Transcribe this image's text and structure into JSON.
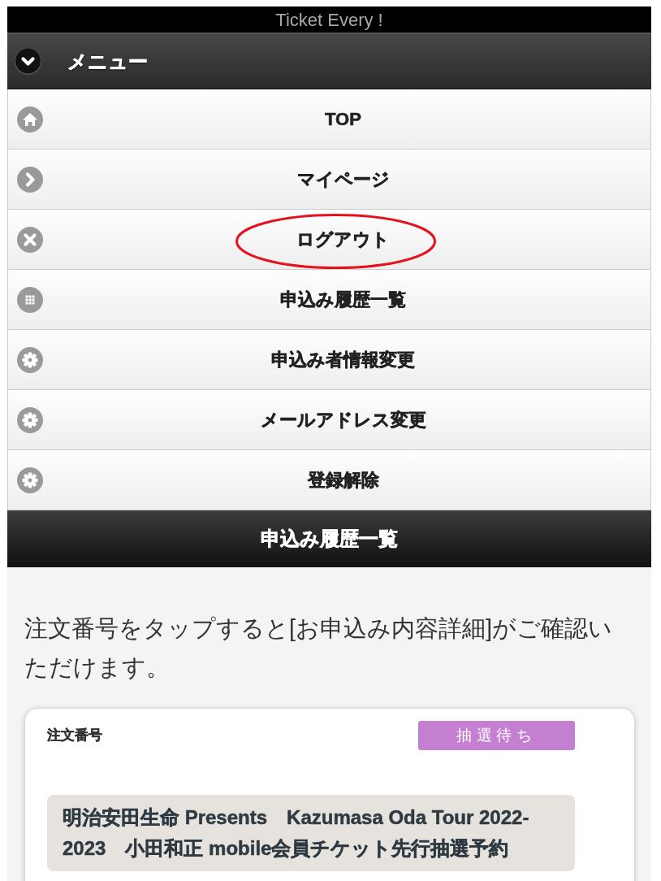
{
  "header": {
    "title": "Ticket Every !"
  },
  "menu": {
    "title": "メニュー",
    "expanded": true,
    "items": [
      {
        "label": "TOP",
        "kind": "home",
        "highlighted": false
      },
      {
        "label": "マイページ",
        "kind": "arrow",
        "highlighted": false
      },
      {
        "label": "ログアウト",
        "kind": "close",
        "highlighted": true
      },
      {
        "label": "申込み履歴一覧",
        "kind": "grid",
        "highlighted": false
      },
      {
        "label": "申込み者情報変更",
        "kind": "gear",
        "highlighted": false
      },
      {
        "label": "メールアドレス変更",
        "kind": "gear",
        "highlighted": false
      },
      {
        "label": "登録解除",
        "kind": "gear",
        "highlighted": false
      }
    ]
  },
  "section": {
    "title": "申込み履歴一覧"
  },
  "intro": "注文番号をタップすると[お申込み内容詳細]がご確認いただけます。",
  "orders": [
    {
      "label": "注文番号",
      "status": "抽選待ち",
      "title": "明治安田生命 Presents　Kazumasa Oda Tour 2022-2023　小田和正 mobile会員チケット先行抽選予約"
    }
  ]
}
